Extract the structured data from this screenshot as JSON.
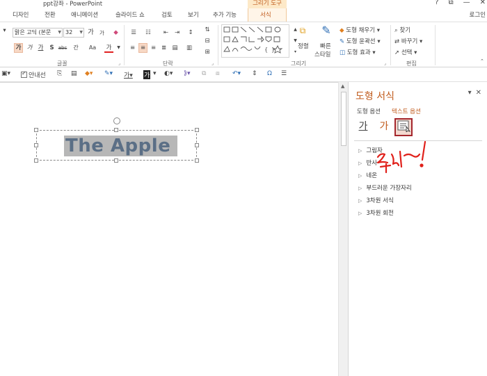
{
  "titlebar": {
    "app_title": "ppt강좌 - PowerPoint",
    "context_tab": "그리기 도구",
    "controls": {
      "help": "?",
      "restore": "⧉",
      "minimize": "—",
      "close": "✕"
    }
  },
  "tabs": {
    "design": "디자인",
    "transitions": "전환",
    "animations": "애니메이션",
    "slideshow": "슬라이드 쇼",
    "review": "검토",
    "view": "보기",
    "addins": "추가 기능",
    "format": "서식",
    "signin": "로그인"
  },
  "ribbon": {
    "font_name": "맑은 고딕 (본문",
    "font_size": "32",
    "grow": "가",
    "shrink": "가",
    "bold": "가",
    "italic": "가",
    "underline": "가",
    "shadow": "S",
    "strike": "abc",
    "spacing": "간 ",
    "case": "Aa",
    "font_color": "가",
    "group_font": "글꼴",
    "group_paragraph": "단락",
    "group_drawing": "그리기",
    "group_editing": "편집",
    "arrange": "정렬",
    "quick_styles_1": "빠른",
    "quick_styles_2": "스타일",
    "shape_fill": "도형 채우기",
    "shape_outline": "도형 윤곽선",
    "shape_effects": "도형 효과",
    "find": "찾기",
    "replace": "바꾸기",
    "select": "선택"
  },
  "qat": {
    "guides": "안내선"
  },
  "slide": {
    "text": "The Apple"
  },
  "pane": {
    "title": "도형 서식",
    "shape_options": "도형 옵션",
    "text_options": "텍스트 옵션",
    "icon_text_fill": "가",
    "icon_text_effects": "가",
    "sections": [
      "그림자",
      "반사",
      "네온",
      "부드러운 가장자리",
      "3차원 서식",
      "3차원 회전"
    ]
  },
  "colors": {
    "accent": "#c05a1b",
    "selected_icon_border": "#a4262c",
    "slide_text": "#5b6f86",
    "highlight": "#b7b7b7",
    "annotation": "#e0201a"
  }
}
